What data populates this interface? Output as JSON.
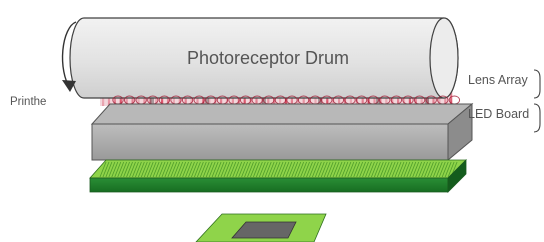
{
  "labels": {
    "drum": "Photoreceptor Drum",
    "printhead": "Printhe",
    "lens_array": "Lens Array",
    "led_board": "LED Board"
  },
  "colors": {
    "drum_fill": "#e6e6e6",
    "drum_stroke": "#404040",
    "box_top": "#b5b5b5",
    "box_front": "#a3a3a3",
    "pcb_dark": "#1f7f2b",
    "pcb_light": "#8fd44a",
    "chip": "#666666",
    "light": "#d0203e"
  },
  "icons": {
    "rotation": "rotation-arrow-icon"
  }
}
